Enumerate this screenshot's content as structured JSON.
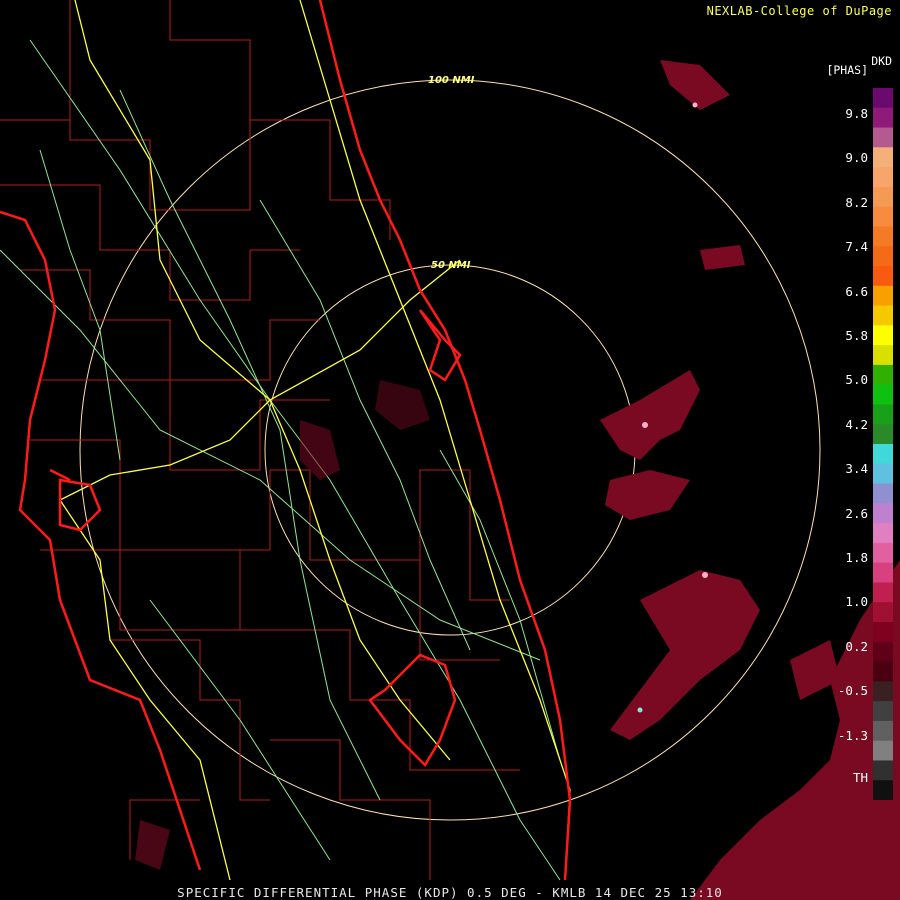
{
  "credit": "NEXLAB-College of DuPage",
  "caption": "SPECIFIC DIFFERENTIAL PHASE (KDP) 0.5 DEG - KMLB 14 DEC 25 13:10",
  "unit": {
    "name": "DKD",
    "product": "[PHAS]"
  },
  "rings": {
    "inner": "50 NMI",
    "outer": "100 NMI"
  },
  "legend": {
    "labels": [
      "9.8",
      "9.0",
      "8.2",
      "7.4",
      "6.6",
      "5.8",
      "5.0",
      "4.2",
      "3.4",
      "2.6",
      "1.8",
      "1.0",
      "0.2",
      "-0.5",
      "-1.3",
      "TH"
    ],
    "colors": [
      "#6b0a6e",
      "#8f1a7a",
      "#b45a8f",
      "#f5b07a",
      "#f7a56a",
      "#f59a55",
      "#f78c40",
      "#f57a28",
      "#f56a18",
      "#f75a10",
      "#f8a000",
      "#f6c800",
      "#ffff00",
      "#d8e000",
      "#30b000",
      "#10c010",
      "#18a018",
      "#2a8a2a",
      "#40d8d8",
      "#60c0e0",
      "#9090d0",
      "#c080d0",
      "#e080c0",
      "#e060a0",
      "#d84080",
      "#c02050",
      "#a01030",
      "#800020",
      "#600018",
      "#4a0010",
      "#3a2020",
      "#404040",
      "#606060",
      "#808080",
      "#303030",
      "#101010"
    ]
  },
  "map_colors": {
    "coast": "#ff1a1a",
    "county": "#b81c1c",
    "road": "#90e890",
    "interstate": "#ffff40",
    "ring": "#ffe0b0",
    "echo": "#7a0a22"
  }
}
